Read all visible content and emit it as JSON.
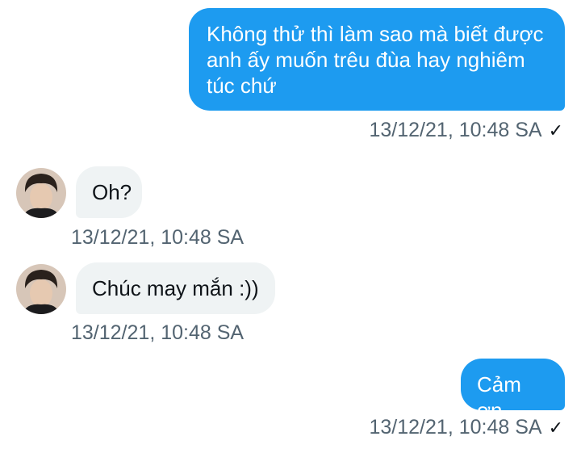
{
  "messages": [
    {
      "direction": "sent",
      "text": "Không thử thì làm sao mà biết được anh ấy muốn trêu đùa hay nghiêm túc chứ",
      "timestamp": "13/12/21, 10:48 SA",
      "status_icon": "check-icon"
    },
    {
      "direction": "received",
      "text": "Oh?",
      "timestamp": "13/12/21, 10:48 SA",
      "avatar": "avatar"
    },
    {
      "direction": "received",
      "text": "Chúc may mắn :))",
      "timestamp": "13/12/21, 10:48 SA",
      "avatar": "avatar"
    },
    {
      "direction": "sent",
      "text": "Cảm ơn",
      "timestamp": "13/12/21, 10:48 SA",
      "status_icon": "check-icon"
    }
  ],
  "colors": {
    "sent_bubble": "#1d9bf0",
    "received_bubble": "#eff3f4",
    "timestamp": "#536471"
  }
}
